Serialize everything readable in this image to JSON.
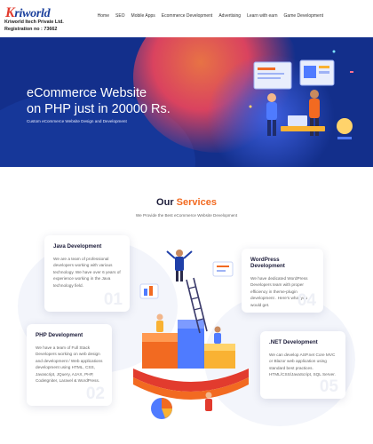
{
  "header": {
    "logo_text": "Kriworld",
    "company": "Kriworld Itech Private Ltd.",
    "registration": "Registration no : 73662",
    "nav": [
      "Home",
      "SEO",
      "Mobile Apps",
      "Ecommerce Development",
      "Advertising",
      "Learn with earn",
      "Game Development"
    ]
  },
  "hero": {
    "title_line1": "eCommerce Website",
    "title_line2": "on PHP just in 20000 Rs.",
    "subtitle": "Custom eCommerce Website Design and Development",
    "background_color": "#132f8b"
  },
  "services": {
    "title_plain": "Our",
    "title_accent": "Services",
    "subtitle": "We Provide the Best eCommerce Website Development",
    "accent_color": "#f26a21",
    "cards": [
      {
        "title": "Java Development",
        "text": "We are a team of professional developers working with various technology. We have over 6 years of experience working in the Java technology field.",
        "number": "01"
      },
      {
        "title": "WordPress Development",
        "text": "We have dedicated WordPress Developers team with proper efficiency in theme-plugin development . Here's what you would get.",
        "number": "04"
      },
      {
        "title": "PHP Development",
        "text": "We have a team of Full Stack Developers working on web design and development / Web applications development using HTML, CSS, Javascript, JQuery, AJAX, PHP, CodeIgniter, Laravel & WordPress.",
        "number": "02"
      },
      {
        "title": ".NET Development",
        "text": "We can develop ASP.net Core MVC or Blazor web application using standard best practices. HTML/CSS/JavaScript, SQL Server.",
        "number": "05"
      }
    ]
  }
}
